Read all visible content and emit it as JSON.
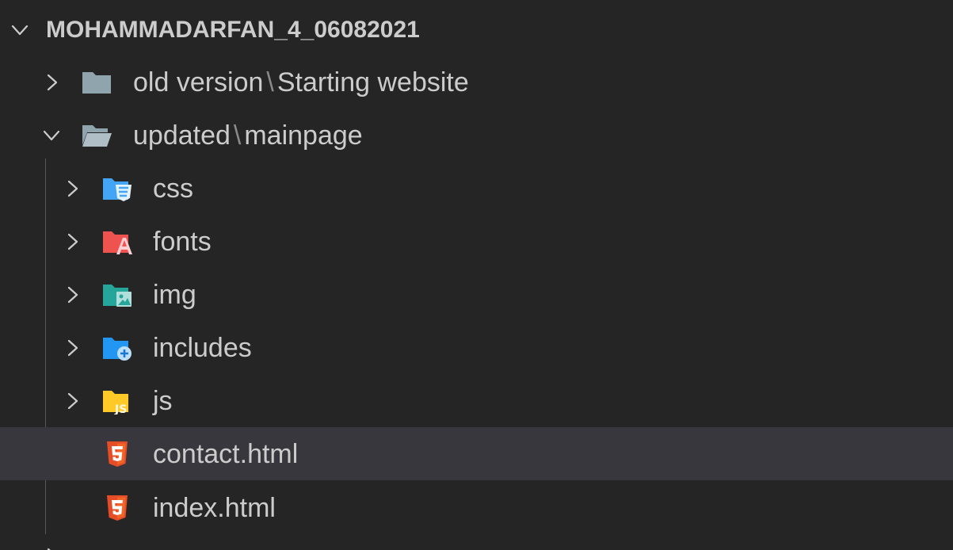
{
  "explorer": {
    "root": {
      "label": "MOHAMMADARFAN_4_06082021",
      "expanded": true
    },
    "items": [
      {
        "name_a": "old version",
        "separator": "\\",
        "name_b": "Starting website",
        "type": "folder",
        "icon": "folder-closed-icon",
        "expanded": false
      },
      {
        "name_a": "updated",
        "separator": "\\",
        "name_b": "mainpage",
        "type": "folder",
        "icon": "folder-open-icon",
        "expanded": true
      },
      {
        "label": "css",
        "type": "folder",
        "icon": "css-folder-icon",
        "color": "#42a5f5",
        "expanded": false
      },
      {
        "label": "fonts",
        "type": "folder",
        "icon": "fonts-folder-icon",
        "color": "#ef5350",
        "expanded": false
      },
      {
        "label": "img",
        "type": "folder",
        "icon": "image-folder-icon",
        "color": "#26a69a",
        "expanded": false
      },
      {
        "label": "includes",
        "type": "folder",
        "icon": "includes-folder-icon",
        "color": "#2196f3",
        "expanded": false
      },
      {
        "label": "js",
        "type": "folder",
        "icon": "js-folder-icon",
        "color": "#ffca28",
        "expanded": false
      },
      {
        "label": "contact.html",
        "type": "file",
        "icon": "html5-icon",
        "color": "#e44d26",
        "selected": true
      },
      {
        "label": "index.html",
        "type": "file",
        "icon": "html5-icon",
        "color": "#e44d26",
        "selected": false
      }
    ]
  }
}
